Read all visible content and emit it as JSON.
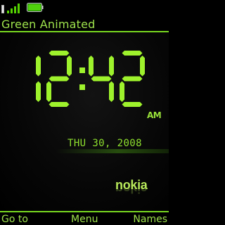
{
  "status": {
    "signal_icon": "signal-strength-icon",
    "battery_icon": "battery-icon",
    "accent": "#55d200"
  },
  "header": {
    "title": "Green Animated"
  },
  "clock": {
    "time": "12:42",
    "period": "AM",
    "date": "THU 30, 2008",
    "digit_color": "#9ef22c"
  },
  "brand": {
    "name": "nokia"
  },
  "softkeys": {
    "left": "Go to",
    "center": "Menu",
    "right": "Names"
  }
}
